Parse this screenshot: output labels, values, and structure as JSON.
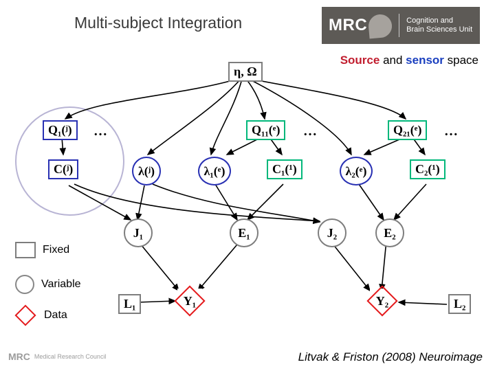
{
  "title": "Multi-subject Integration",
  "logo": {
    "main": "MRC",
    "sub1": "Cognition and",
    "sub2": "Brain Sciences Unit"
  },
  "subtitle": {
    "part1": "Source",
    "and": " and ",
    "part2": "sensor",
    "part3": " space"
  },
  "legend": {
    "fixed": "Fixed",
    "variable": "Variable",
    "data": "Data"
  },
  "citation": "Litvak & Friston (2008) Neuroimage",
  "footer": "Medical Research Council",
  "nodes": {
    "eta": "η, Ω",
    "Qj": "Q₁(ʲ)",
    "Qe11": "Q₁₁(ᵉ)",
    "Qe21": "Q₂₁(ᵉ)",
    "Cj": "C(ʲ)",
    "lamj": "λ(ʲ)",
    "lam1e": "λ₁(ᵉ)",
    "C1": "C₁(¹)",
    "lam2e": "λ₂(ᵉ)",
    "C2": "C₂(¹)",
    "J1": "J₁",
    "E1": "E₁",
    "J2": "J₂",
    "E2": "E₂",
    "L1": "L₁",
    "Y1": "Y₁",
    "L2": "L₂",
    "Y2": "Y₂",
    "dots": "…"
  }
}
